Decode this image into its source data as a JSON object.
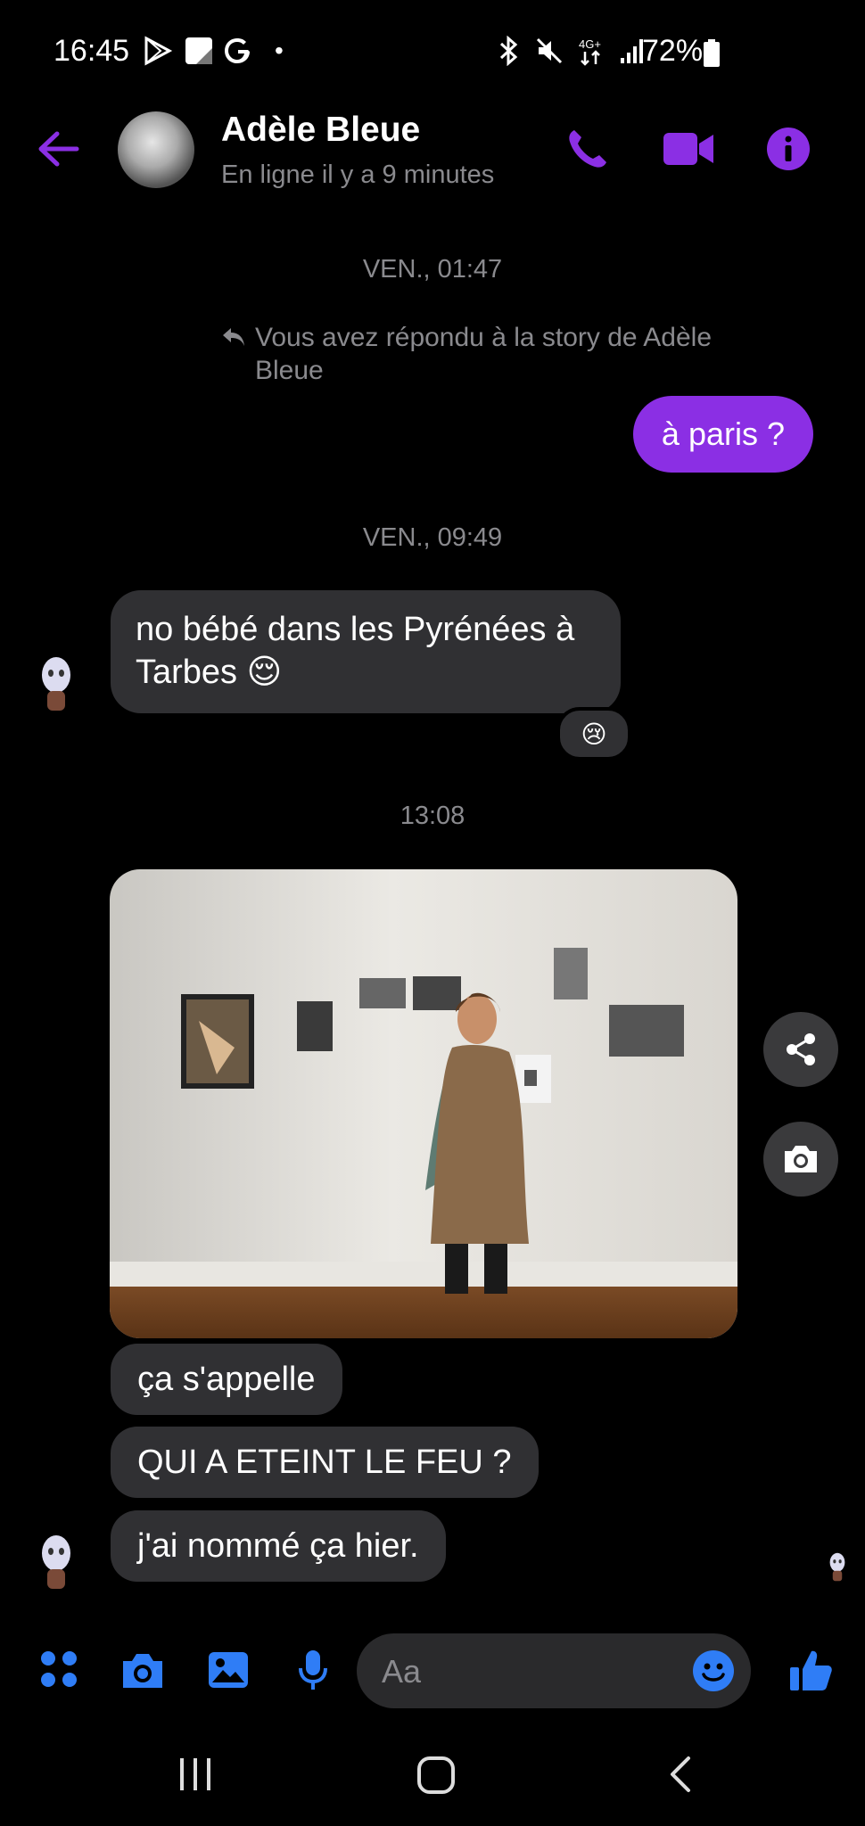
{
  "status_bar": {
    "time": "16:45",
    "battery": "72%",
    "network": "4G+"
  },
  "header": {
    "name": "Adèle Bleue",
    "status": "En ligne il y a 9 minutes"
  },
  "thread": {
    "ts1": "VEN., 01:47",
    "reply_note": "Vous avez répondu à la story de Adèle Bleue",
    "sent_msg": "à paris ?",
    "ts2": "VEN., 09:49",
    "recv_msg1": "no bébé dans les Pyrénées à Tarbes 😌",
    "reaction": "😢",
    "ts3": "13:08",
    "recv_msg2": "ça s'appelle",
    "recv_msg3": "QUI A ETEINT LE FEU ?",
    "recv_msg4": "j'ai nommé ça hier."
  },
  "composer": {
    "placeholder": "Aa"
  },
  "colors": {
    "accent_purple": "#8b2fe4",
    "accent_blue": "#2f7df6",
    "bubble_gray": "#303033"
  }
}
